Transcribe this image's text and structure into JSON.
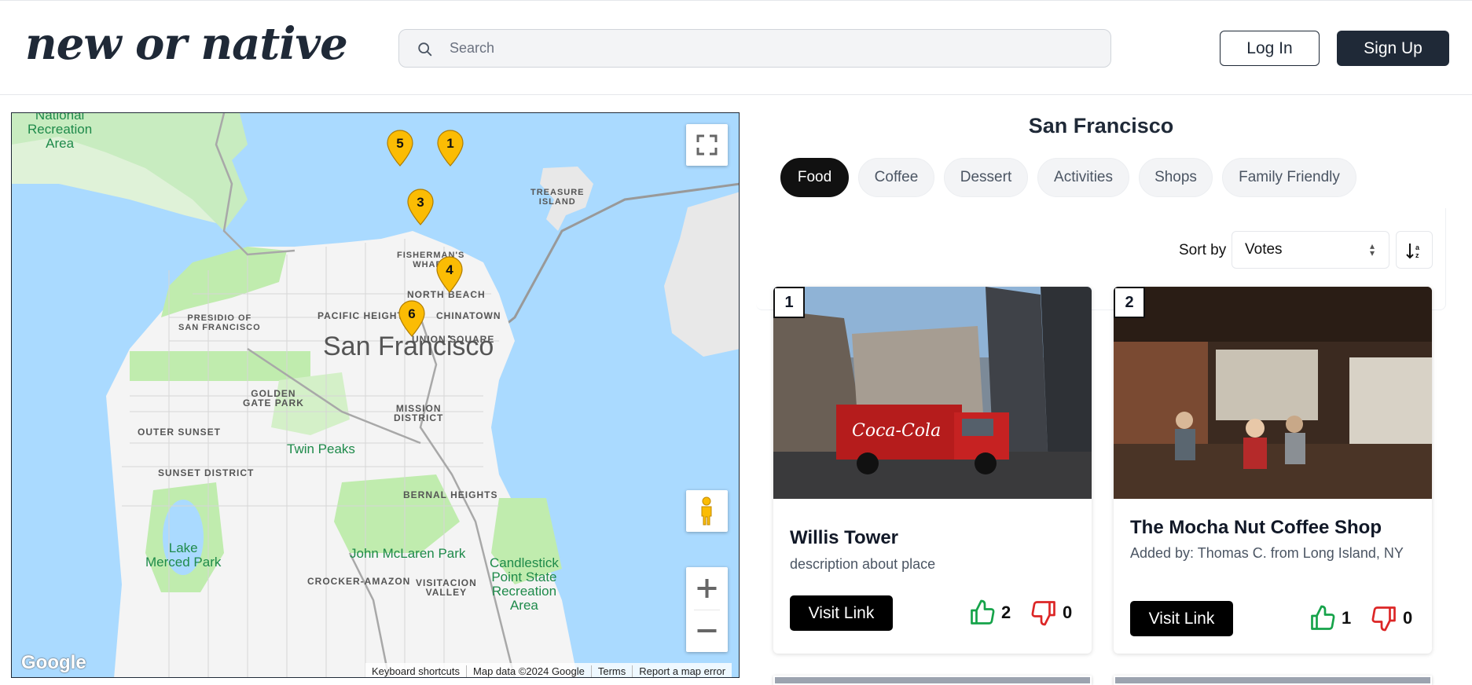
{
  "header": {
    "logo": "new or native",
    "search_placeholder": "Search",
    "login_label": "Log In",
    "signup_label": "Sign Up"
  },
  "map": {
    "city_label": "San Francisco",
    "neighborhoods": [
      "National Recreation Area",
      "TREASURE ISLAND",
      "FISHERMAN'S WHARF",
      "NORTH BEACH",
      "PACIFIC HEIGHTS",
      "CHINATOWN",
      "PRESIDIO OF SAN FRANCISCO",
      "UNION SQUARE",
      "GOLDEN GATE PARK",
      "MISSION DISTRICT",
      "OUTER SUNSET",
      "Twin Peaks",
      "SUNSET DISTRICT",
      "BERNAL HEIGHTS",
      "Lake Merced Park",
      "John McLaren Park",
      "CROCKER-AMAZON",
      "VISITACION VALLEY",
      "Candlestick Point State Recreation Area"
    ],
    "labels": {
      "national": "National\nRecreation\nArea",
      "treasure": "TREASURE\nISLAND",
      "wharf": "FISHERMAN'S\nWHARF",
      "north_beach": "NORTH BEACH",
      "pacific": "PACIFIC HEIGHTS",
      "chinatown": "CHINATOWN",
      "presidio": "PRESIDIO OF\nSAN FRANCISCO",
      "union": "UNION SQUARE",
      "golden_gate": "GOLDEN\nGATE PARK",
      "mission": "MISSION\nDISTRICT",
      "outer_sunset": "OUTER SUNSET",
      "twin_peaks": "Twin Peaks",
      "sunset": "SUNSET DISTRICT",
      "bernal": "BERNAL HEIGHTS",
      "lake_merced": "Lake\nMerced Park",
      "mclaren": "John McLaren Park",
      "crocker": "CROCKER-AMAZON",
      "visitacion": "VISITACION\nVALLEY",
      "candlestick": "Candlestick\nPoint State\nRecreation\nArea"
    },
    "pins": [
      "5",
      "1",
      "3",
      "4",
      "6"
    ],
    "attribution": [
      "Keyboard shortcuts",
      "Map data ©2024 Google",
      "Terms",
      "Report a map error"
    ],
    "google_logo": "Google"
  },
  "panel": {
    "city_title": "San Francisco",
    "categories": [
      "Food",
      "Coffee",
      "Dessert",
      "Activities",
      "Shops",
      "Family Friendly"
    ],
    "active_category": "Food",
    "sort_label": "Sort by",
    "sort_value": "Votes"
  },
  "places": [
    {
      "rank": "1",
      "title": "Willis Tower",
      "description": "description about place",
      "visit_label": "Visit Link",
      "upvotes": "2",
      "downvotes": "0"
    },
    {
      "rank": "2",
      "title": "The Mocha Nut Coffee Shop",
      "description": "Added by: Thomas C. from Long Island, NY",
      "visit_label": "Visit Link",
      "upvotes": "1",
      "downvotes": "0"
    }
  ],
  "colors": {
    "brand_dark": "#1f2937",
    "upvote": "#16a34a",
    "downvote": "#dc2626",
    "pin": "#fbbc04",
    "water": "#aadaff",
    "park": "#c0ecae"
  }
}
